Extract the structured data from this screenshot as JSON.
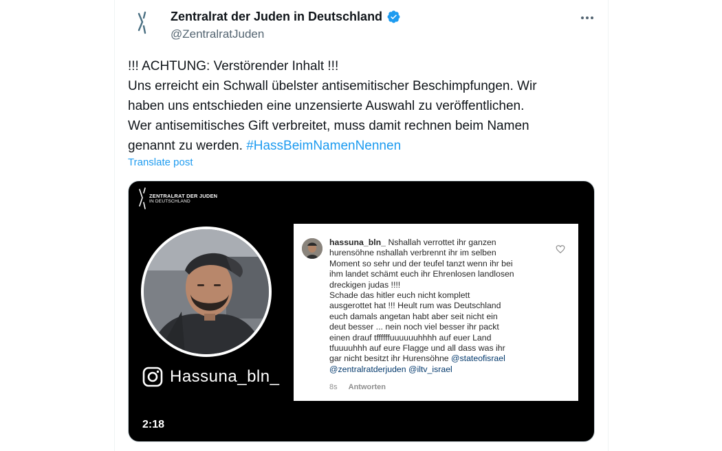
{
  "account": {
    "display_name": "Zentralrat der Juden in Deutschland",
    "handle": "@ZentralratJuden",
    "verified": true
  },
  "tweet": {
    "lines": [
      "!!! ACHTUNG: Verstörender Inhalt !!!",
      "Uns erreicht ein Schwall übelster antisemitischer Beschimpfungen. Wir",
      "haben uns entschieden eine unzensierte Auswahl zu veröffentlichen.",
      "Wer antisemitisches Gift verbreitet, muss damit rechnen beim Namen"
    ],
    "last_line_text": "genannt zu werden. ",
    "hashtag": "#HassBeimNamenNennen",
    "translate_label": "Translate post"
  },
  "media": {
    "org_name": "ZENTRALRAT DER JUDEN",
    "org_sub": "IN DEUTSCHLAND",
    "instagram_handle": "Hassuna_bln_",
    "duration": "2:18",
    "comment": {
      "username": "hassuna_bln_",
      "lines": [
        "Nshallah verrottet ihr ganzen",
        "hurensöhne nshallah verbrennt ihr im selben",
        "Moment so sehr und der teufel tanzt wenn ihr bei",
        "ihm landet schämt euch ihr Ehrenlosen landlosen",
        "dreckigen judas !!!!",
        "Schade das hitler euch nicht komplett",
        "ausgerottet hat !!! Heult rum was Deutschland",
        "euch damals angetan habt aber seit nicht ein",
        "deut besser ... nein noch viel besser ihr packt",
        "einen drauf tffffffuuuuuuhhhh auf euer Land",
        "tfuuuuhhh auf eure Flagge und all dass was ihr",
        "gar nicht besitzt ihr Hurensöhne "
      ],
      "mention1": "@stateofisrael",
      "mention2": "@zentralratderjuden",
      "mention3": "@iltv_israel",
      "time": "8s",
      "reply_label": "Antworten"
    }
  },
  "colors": {
    "link": "#1d9bf0",
    "verified": "#1d9bf0",
    "text": "#0f1419",
    "muted": "#536471",
    "media_bg": "#000000"
  },
  "icons": [
    "zentralrat-logo-icon",
    "verified-badge-icon",
    "more-options-icon",
    "instagram-icon",
    "heart-icon"
  ]
}
